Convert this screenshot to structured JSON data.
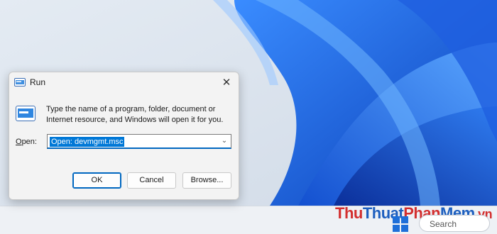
{
  "dialog": {
    "title": "Run",
    "description": "Type the name of a program, folder, document or Internet resource, and Windows will open it for you.",
    "open_label": "Open:",
    "open_label_accel": "O",
    "open_label_rest": "pen:",
    "input_value": "Open: devmgmt.msc",
    "buttons": {
      "ok": "OK",
      "cancel": "Cancel",
      "browse": "Browse..."
    }
  },
  "taskbar": {
    "search_placeholder": "Search"
  },
  "watermark": {
    "part1": "Thu",
    "part2": "Thuat",
    "part3": "Phan",
    "part4": "Mem",
    "part5": ".vn"
  },
  "colors": {
    "accent": "#0067c0",
    "selection": "#0078d7",
    "wallpaper_blue": "#1e6fd9"
  }
}
